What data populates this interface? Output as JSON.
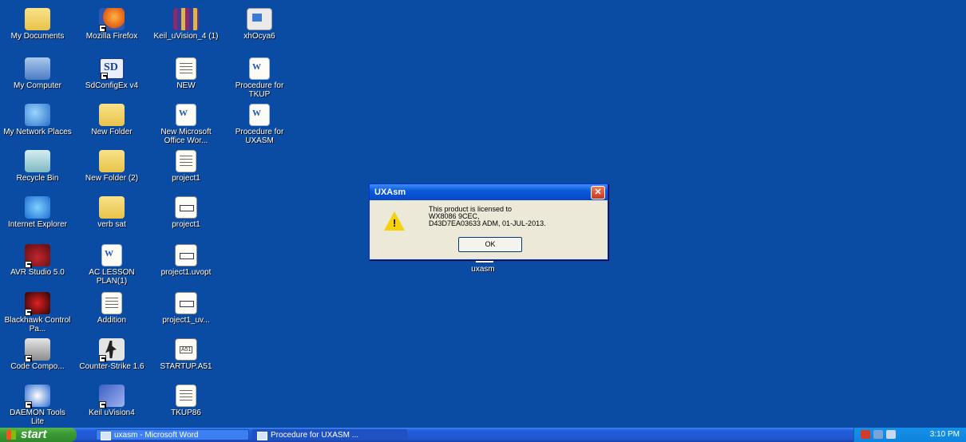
{
  "desktop": {
    "icons": [
      {
        "label": "My Documents",
        "icon": "my-documents-icon"
      },
      {
        "label": "Mozilla Firefox",
        "icon": "firefox-icon"
      },
      {
        "label": "Keil_uVision_4 (1)",
        "icon": "keil-icon"
      },
      {
        "label": "xhOcya6",
        "icon": "image-file-icon"
      },
      {
        "label": "My Computer",
        "icon": "my-computer-icon"
      },
      {
        "label": "SdConfigEx v4",
        "icon": "sdconfig-icon"
      },
      {
        "label": "NEW",
        "icon": "text-file-icon"
      },
      {
        "label": "Procedure for TKUP",
        "icon": "word-doc-icon"
      },
      {
        "label": "My Network Places",
        "icon": "network-places-icon"
      },
      {
        "label": "New Folder",
        "icon": "folder-icon"
      },
      {
        "label": "New Microsoft Office Wor...",
        "icon": "word-doc-icon"
      },
      {
        "label": "Procedure for UXASM",
        "icon": "word-doc-icon"
      },
      {
        "label": "Recycle Bin",
        "icon": "recycle-bin-icon"
      },
      {
        "label": "New Folder (2)",
        "icon": "folder-icon"
      },
      {
        "label": "project1",
        "icon": "text-file-icon"
      },
      {
        "label": "Internet Explorer",
        "icon": "internet-explorer-icon"
      },
      {
        "label": "verb sat",
        "icon": "folder-icon"
      },
      {
        "label": "project1",
        "icon": "uvproj-file-icon"
      },
      {
        "label": "AVR Studio 5.0",
        "icon": "avr-studio-icon"
      },
      {
        "label": "AC LESSON PLAN(1)",
        "icon": "word-doc-icon"
      },
      {
        "label": "project1.uvopt",
        "icon": "uvopt-file-icon"
      },
      {
        "label": "Blackhawk Control Pa...",
        "icon": "blackhawk-icon"
      },
      {
        "label": "Addition",
        "icon": "text-file-icon"
      },
      {
        "label": "project1_uv...",
        "icon": "uvproj-file-icon"
      },
      {
        "label": "Code Compo...",
        "icon": "code-composer-icon"
      },
      {
        "label": "Counter-Strike 1.6",
        "icon": "counter-strike-icon"
      },
      {
        "label": "STARTUP.A51",
        "icon": "asm-file-icon"
      },
      {
        "label": "DAEMON Tools Lite",
        "icon": "daemon-tools-icon"
      },
      {
        "label": "Keil uVision4",
        "icon": "keil-uvision4-icon"
      },
      {
        "label": "TKUP86",
        "icon": "text-file-icon"
      }
    ],
    "uxasm_label": "uxasm"
  },
  "dialog": {
    "title": "UXAsm",
    "close": "✕",
    "line1": "This product is licensed to",
    "line2": "WX8086 9CEC,",
    "line3": "D43D7EA03633 ADM, 01-JUL-2013.",
    "ok": "OK",
    "icon": "warning-icon"
  },
  "taskbar": {
    "start": "start",
    "tasks": [
      {
        "label": "uxasm - Microsoft Word"
      },
      {
        "label": "Procedure for UXASM ..."
      }
    ],
    "clock": "3:10 PM"
  }
}
